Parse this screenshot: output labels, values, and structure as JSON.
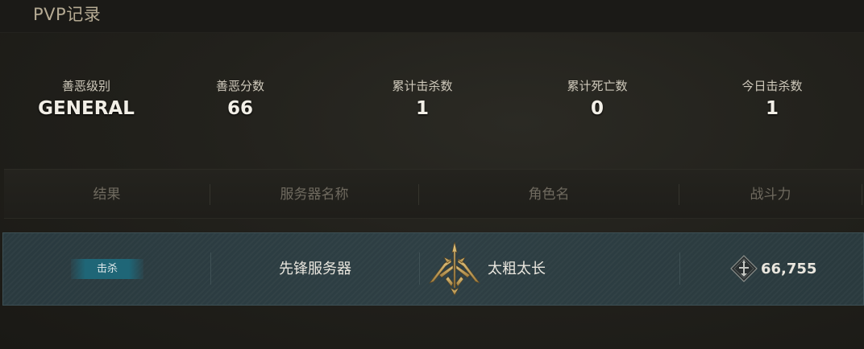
{
  "header": {
    "title": "PVP记录"
  },
  "stats": [
    {
      "label": "善恶级别",
      "value": "GENERAL"
    },
    {
      "label": "善恶分数",
      "value": "66"
    },
    {
      "label": "累计击杀数",
      "value": "1"
    },
    {
      "label": "累计死亡数",
      "value": "0"
    },
    {
      "label": "今日击杀数",
      "value": "1"
    }
  ],
  "table": {
    "columns": [
      "结果",
      "服务器名称",
      "角色名",
      "战斗力"
    ],
    "rows": [
      {
        "result": "击杀",
        "server": "先锋服务器",
        "character": "太粗太长",
        "class_icon": "trident-class-icon",
        "power_icon": "combat-power-icon",
        "power": "66,755"
      }
    ]
  },
  "colors": {
    "background": "#1e1d19",
    "title": "#b5aa93",
    "row_highlight": "#2e3f44",
    "badge": "#1f6677",
    "class_icon_gold": "#c9a45a"
  }
}
